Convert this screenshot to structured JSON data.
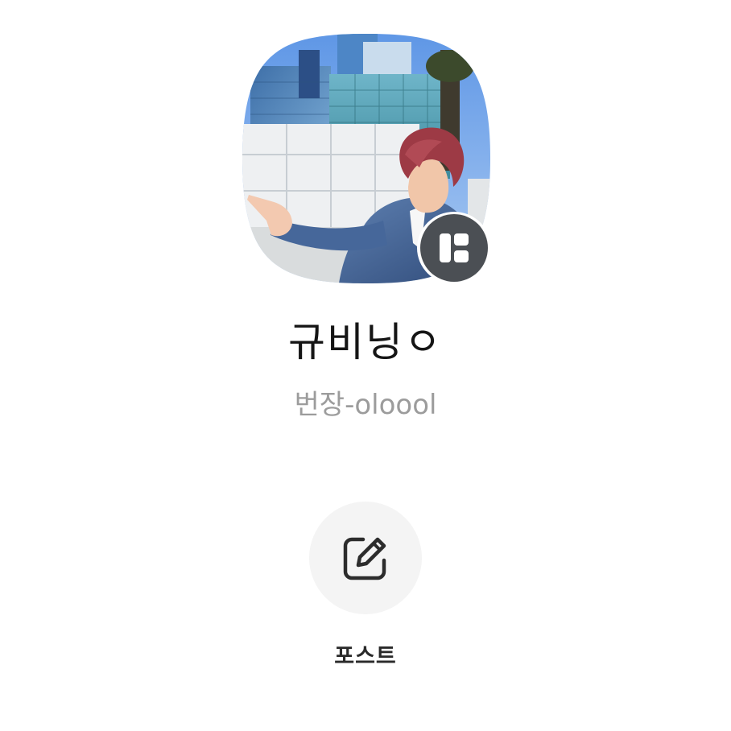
{
  "profile": {
    "name": "규비닝ㅇ",
    "status_message": "번장-oloool",
    "avatar_icon": "profile-photo",
    "badge_icon": "profile-card-icon"
  },
  "actions": [
    {
      "label": "포스트",
      "icon": "edit-icon"
    }
  ],
  "colors": {
    "badge_background": "#4b4f54",
    "name_text": "#151515",
    "status_text": "#9c9c9c",
    "action_circle": "#f4f4f4"
  }
}
